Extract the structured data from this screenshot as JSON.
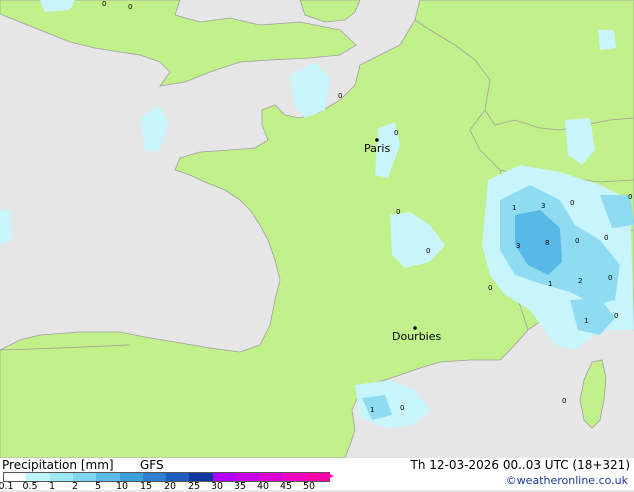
{
  "map": {
    "cities": [
      {
        "name": "Paris"
      },
      {
        "name": "Dourbies"
      }
    ],
    "precip_labels": [
      "0",
      "0",
      "0",
      "1",
      "3",
      "0",
      "0",
      "3",
      "8",
      "0",
      "0",
      "0",
      "1",
      "2",
      "0",
      "1",
      "0",
      "1",
      "0",
      "0",
      "0",
      "0",
      "0"
    ]
  },
  "footer": {
    "left_title": "Precipitation [mm]",
    "model": "GFS",
    "timestamp": "Th 12-03-2026 00..03 UTC (18+321)",
    "copyright": "©weatheronline.co.uk",
    "scale_ticks": [
      "0.1",
      "0.5",
      "1",
      "2",
      "5",
      "10",
      "15",
      "20",
      "25",
      "30",
      "35",
      "40",
      "45",
      "50"
    ],
    "scale_colors": [
      "#fdfdfd",
      "#bff6fb",
      "#9fe8f5",
      "#7fd5ee",
      "#5cbbe6",
      "#3f9fdb",
      "#2f7fd0",
      "#1f5cc0",
      "#1038a0",
      "#b000ff",
      "#c600e8",
      "#dc00d4",
      "#ee00c0",
      "#ff00a8"
    ]
  },
  "colors": {
    "land": "#c2f08a",
    "sea": "#e6e6e6",
    "border": "#a0a0a0",
    "precip_light": "#c8f4fb",
    "precip_mid": "#8fdcf2",
    "precip_heavy": "#58b8e6"
  }
}
